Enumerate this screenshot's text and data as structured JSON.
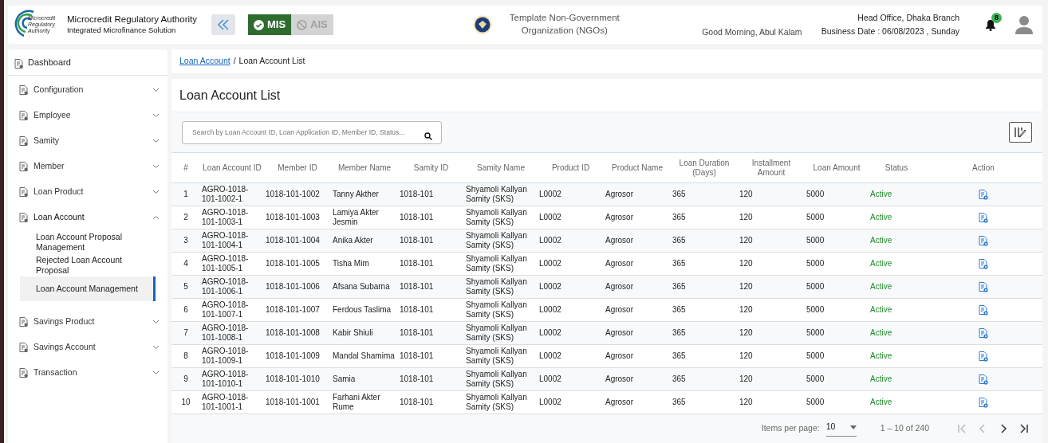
{
  "header": {
    "title": "Microcredit Regulatory Authority",
    "subtitle": "Integrated Microfinance Solution",
    "logo_text": [
      "Microcredit",
      "Regulatory",
      "Authority"
    ],
    "modules": [
      {
        "label": "MIS",
        "selected": true
      },
      {
        "label": "AIS",
        "selected": false
      }
    ],
    "organization": "Template Non-Government Organization (NGOs)",
    "greeting": "Good Morning, Abul Kalam",
    "branch": "Head Office, Dhaka Branch",
    "business_date": "Business Date : 06/08/2023 , Sunday",
    "notification_count": "8"
  },
  "sidebar": {
    "dashboard": "Dashboard",
    "items": [
      {
        "label": "Configuration",
        "expanded": false
      },
      {
        "label": "Employee",
        "expanded": false
      },
      {
        "label": "Samity",
        "expanded": false
      },
      {
        "label": "Member",
        "expanded": false
      },
      {
        "label": "Loan Product",
        "expanded": false
      },
      {
        "label": "Loan Account",
        "expanded": true,
        "children": [
          {
            "label": "Loan Account Proposal Management",
            "selected": false
          },
          {
            "label": "Rejected Loan Account Proposal",
            "selected": false
          },
          {
            "label": "Loan Account Management",
            "selected": true
          }
        ]
      },
      {
        "label": "Savings Product",
        "expanded": false
      },
      {
        "label": "Savings Account",
        "expanded": false
      },
      {
        "label": "Transaction",
        "expanded": false
      }
    ]
  },
  "breadcrumb": {
    "items": [
      "Loan Account",
      "Loan Account List"
    ],
    "separator": "/"
  },
  "page_title": "Loan Account List",
  "search": {
    "placeholder": "Search by Loan Account ID, Loan Application ID, Member ID, Status..."
  },
  "table": {
    "columns": [
      "#",
      "Loan Account ID",
      "Member ID",
      "Member Name",
      "Samity ID",
      "Samity Name",
      "Product ID",
      "Product Name",
      "Loan Duration (Days)",
      "Installment Amount",
      "Loan Amount",
      "Status",
      "Action"
    ],
    "rows": [
      [
        "1",
        "AGRO-1018-101-1002-1",
        "1018-101-1002",
        "Tanny Akther",
        "1018-101",
        "Shyamoli Kallyan Samity (SKS)",
        "L0002",
        "Agrosor",
        "365",
        "120",
        "5000",
        "Active"
      ],
      [
        "2",
        "AGRO-1018-101-1003-1",
        "1018-101-1003",
        "Lamiya Akter Jesmin",
        "1018-101",
        "Shyamoli Kallyan Samity (SKS)",
        "L0002",
        "Agrosor",
        "365",
        "120",
        "5000",
        "Active"
      ],
      [
        "3",
        "AGRO-1018-101-1004-1",
        "1018-101-1004",
        "Anika Akter",
        "1018-101",
        "Shyamoli Kallyan Samity (SKS)",
        "L0002",
        "Agrosor",
        "365",
        "120",
        "5000",
        "Active"
      ],
      [
        "4",
        "AGRO-1018-101-1005-1",
        "1018-101-1005",
        "Tisha Mim",
        "1018-101",
        "Shyamoli Kallyan Samity (SKS)",
        "L0002",
        "Agrosor",
        "365",
        "120",
        "5000",
        "Active"
      ],
      [
        "5",
        "AGRO-1018-101-1006-1",
        "1018-101-1006",
        "Afsana Subarna",
        "1018-101",
        "Shyamoli Kallyan Samity (SKS)",
        "L0002",
        "Agrosor",
        "365",
        "120",
        "5000",
        "Active"
      ],
      [
        "6",
        "AGRO-1018-101-1007-1",
        "1018-101-1007",
        "Ferdous Taslima",
        "1018-101",
        "Shyamoli Kallyan Samity (SKS)",
        "L0002",
        "Agrosor",
        "365",
        "120",
        "5000",
        "Active"
      ],
      [
        "7",
        "AGRO-1018-101-1008-1",
        "1018-101-1008",
        "Kabir Shiuli",
        "1018-101",
        "Shyamoli Kallyan Samity (SKS)",
        "L0002",
        "Agrosor",
        "365",
        "120",
        "5000",
        "Active"
      ],
      [
        "8",
        "AGRO-1018-101-1009-1",
        "1018-101-1009",
        "Mandal Shamima",
        "1018-101",
        "Shyamoli Kallyan Samity (SKS)",
        "L0002",
        "Agrosor",
        "365",
        "120",
        "5000",
        "Active"
      ],
      [
        "9",
        "AGRO-1018-101-1010-1",
        "1018-101-1010",
        "Samia",
        "1018-101",
        "Shyamoli Kallyan Samity (SKS)",
        "L0002",
        "Agrosor",
        "365",
        "120",
        "5000",
        "Active"
      ],
      [
        "10",
        "AGRO-1018-101-1001-1",
        "1018-101-1001",
        "Farhani Akter Rume",
        "1018-101",
        "Shyamoli Kallyan Samity (SKS)",
        "L0002",
        "Agrosor",
        "365",
        "120",
        "5000",
        "Active"
      ]
    ]
  },
  "paginator": {
    "label": "Items per page:",
    "page_size": "10",
    "range": "1 – 10 of 240",
    "buttons": [
      {
        "kind": "first",
        "disabled": true
      },
      {
        "kind": "previous",
        "disabled": true
      },
      {
        "kind": "next",
        "disabled": false
      },
      {
        "kind": "last",
        "disabled": false
      }
    ]
  }
}
